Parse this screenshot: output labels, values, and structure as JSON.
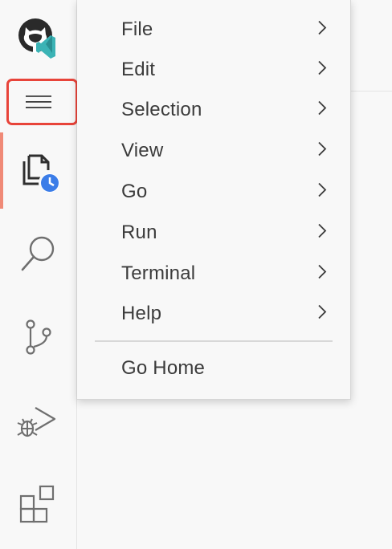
{
  "activity_bar": {
    "items": [
      {
        "name": "github-vscode-logo-icon"
      },
      {
        "name": "hamburger-menu-icon"
      },
      {
        "name": "timeline-explorer-icon"
      },
      {
        "name": "search-icon"
      },
      {
        "name": "source-control-icon"
      },
      {
        "name": "run-debug-icon"
      },
      {
        "name": "extensions-icon"
      }
    ],
    "active_indicator_color": "#f08a77",
    "highlight_color": "#e8443a"
  },
  "menu": {
    "items": [
      {
        "label": "File",
        "submenu": true
      },
      {
        "label": "Edit",
        "submenu": true
      },
      {
        "label": "Selection",
        "submenu": true
      },
      {
        "label": "View",
        "submenu": true
      },
      {
        "label": "Go",
        "submenu": true
      },
      {
        "label": "Run",
        "submenu": true
      },
      {
        "label": "Terminal",
        "submenu": true
      },
      {
        "label": "Help",
        "submenu": true
      }
    ],
    "footer_item": {
      "label": "Go Home",
      "submenu": false
    }
  }
}
